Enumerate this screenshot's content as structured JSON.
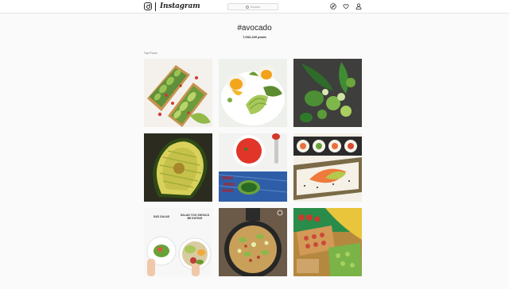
{
  "header": {
    "wordmark": "Instagram",
    "search_placeholder": "Search",
    "icons": [
      "instagram-glyph-icon",
      "compass-icon",
      "heart-icon",
      "person-icon"
    ]
  },
  "hashtag": {
    "title": "#avocado",
    "post_count": "7,032,249 posts"
  },
  "top_posts": {
    "label": "Top Posts",
    "posts": [
      {
        "id": "post-1"
      },
      {
        "id": "post-2"
      },
      {
        "id": "post-3"
      },
      {
        "id": "post-4"
      },
      {
        "id": "post-5"
      },
      {
        "id": "post-6"
      },
      {
        "id": "post-7",
        "caption_left": "SAD SALAD",
        "caption_right": "SALAD YOU SHOULD BE EATING"
      },
      {
        "id": "post-8"
      },
      {
        "id": "post-9"
      }
    ]
  },
  "colors": {
    "background": "#fafafa",
    "header_bg": "#ffffff",
    "text": "#262626"
  }
}
